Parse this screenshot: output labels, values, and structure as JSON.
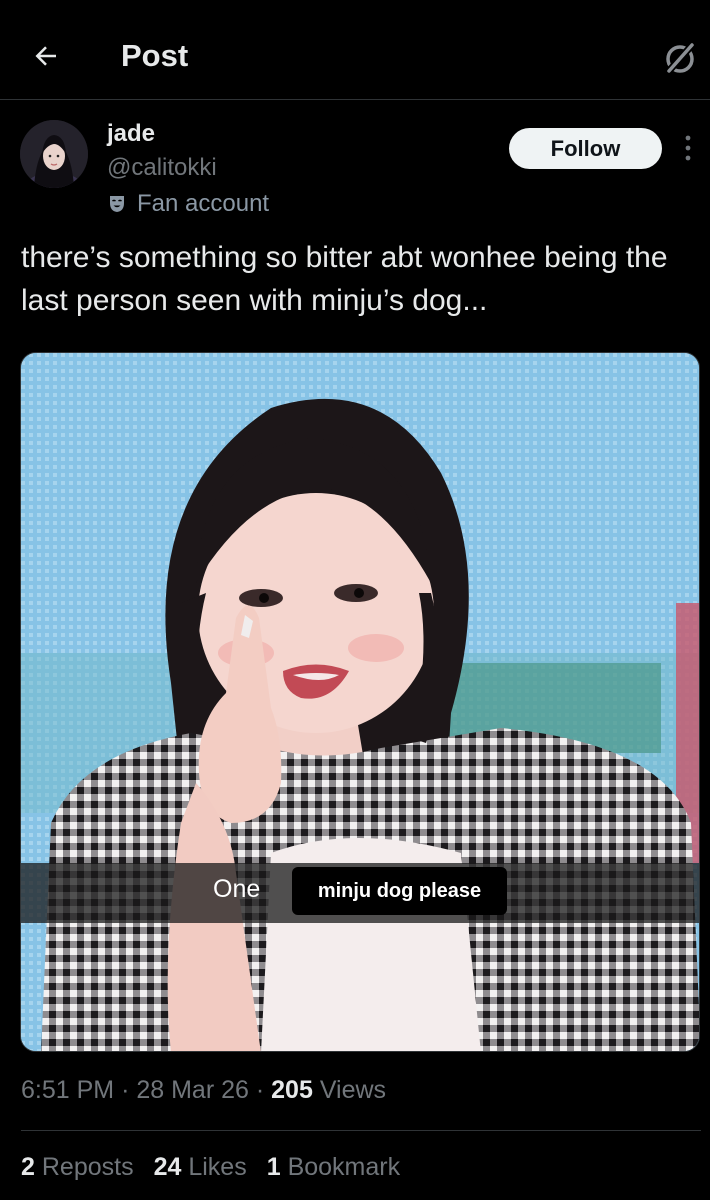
{
  "header": {
    "title": "Post",
    "back_icon": "arrow-left-icon",
    "grok_icon": "grok-icon"
  },
  "author": {
    "name": "jade",
    "handle": "@calitokki",
    "label": "Fan account",
    "label_icon": "theater-mask-icon",
    "follow_label": "Follow",
    "more_icon": "more-vertical-icon"
  },
  "tweet": {
    "text": "there’s something so bitter abt wonhee being the last person seen with minju’s dog..."
  },
  "media": {
    "caption_prefix": "One",
    "caption_box": "minju dog please"
  },
  "meta": {
    "time": "6:51 PM",
    "separator": "·",
    "date": "28 Mar 26",
    "views_count": "205",
    "views_label": "Views"
  },
  "stats": {
    "reposts_count": "2",
    "reposts_label": "Reposts",
    "likes_count": "24",
    "likes_label": "Likes",
    "bookmarks_count": "1",
    "bookmarks_label": "Bookmark"
  },
  "colors": {
    "background": "#000000",
    "text_primary": "#e7e9ea",
    "text_secondary": "#71767b",
    "border": "#2f3336",
    "follow_bg": "#eff3f4"
  }
}
